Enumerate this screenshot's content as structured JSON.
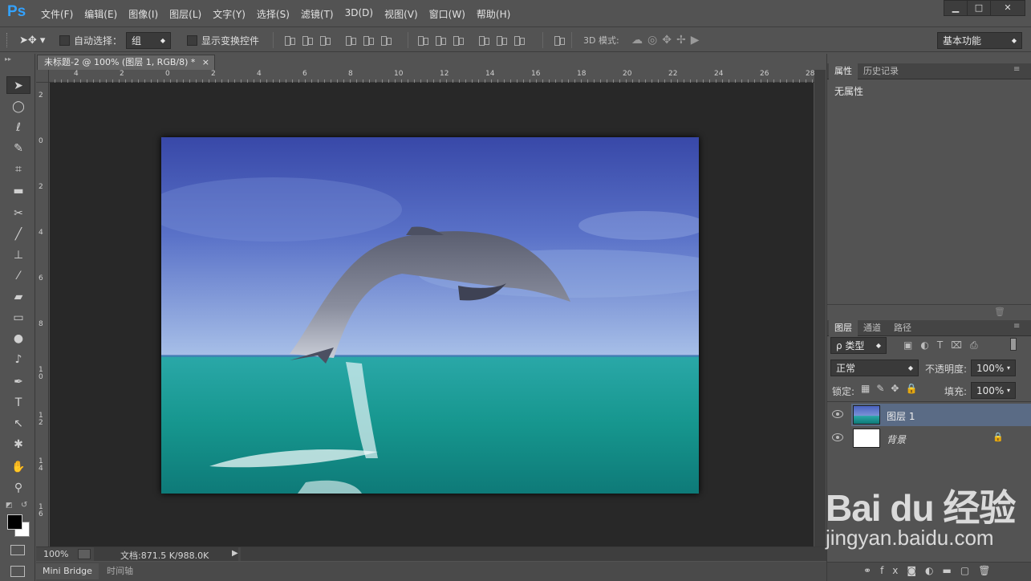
{
  "app": {
    "logo": "Ps"
  },
  "menu": [
    "文件(F)",
    "编辑(E)",
    "图像(I)",
    "图层(L)",
    "文字(Y)",
    "选择(S)",
    "滤镜(T)",
    "3D(D)",
    "视图(V)",
    "窗口(W)",
    "帮助(H)"
  ],
  "window_controls": {
    "minimize": "▁",
    "maximize": "□",
    "close": "✕"
  },
  "options": {
    "auto_select_label": "自动选择：",
    "auto_select_value": "组",
    "show_transform_label": "显示变换控件",
    "mode_3d_label": "3D 模式:",
    "workspace_value": "基本功能"
  },
  "document": {
    "tab_title": "未标题-2 @ 100% (图层 1, RGB/8) *",
    "close_glyph": "×",
    "hruler_ticks": [
      "4",
      "2",
      "0",
      "2",
      "4",
      "6",
      "8",
      "10",
      "12",
      "14",
      "16",
      "18",
      "20",
      "22",
      "24",
      "26",
      "28"
    ],
    "vruler_ticks": [
      "2",
      "0",
      "2",
      "4",
      "6",
      "8",
      "1 0",
      "1 2",
      "1 4",
      "1 6"
    ]
  },
  "status": {
    "zoom": "100%",
    "doc_info": "文档:871.5 K/988.0K"
  },
  "bottom_tabs": [
    "Mini Bridge",
    "时间轴"
  ],
  "properties_panel": {
    "tabs": [
      "属性",
      "历史记录"
    ],
    "content": "无属性"
  },
  "layers_panel": {
    "tabs": [
      "图层",
      "通道",
      "路径"
    ],
    "filter_label": "ρ 类型",
    "blend_mode": "正常",
    "opacity_label": "不透明度:",
    "opacity_value": "100%",
    "lock_label": "锁定:",
    "fill_label": "填充:",
    "fill_value": "100%",
    "layers": [
      {
        "name": "图层 1"
      },
      {
        "name": "背景"
      }
    ],
    "footer_icons": [
      "link-icon",
      "fx-icon",
      "mask-icon",
      "adjustment-icon",
      "group-icon",
      "new-layer-icon",
      "trash-icon"
    ]
  },
  "watermark": {
    "brand": "Bai du 经验",
    "url": "jingyan.baidu.com"
  },
  "colors": {
    "accent": "#33a2ff",
    "panel": "#535353",
    "canvas": "#282828",
    "selected_layer": "#5a6b85"
  }
}
